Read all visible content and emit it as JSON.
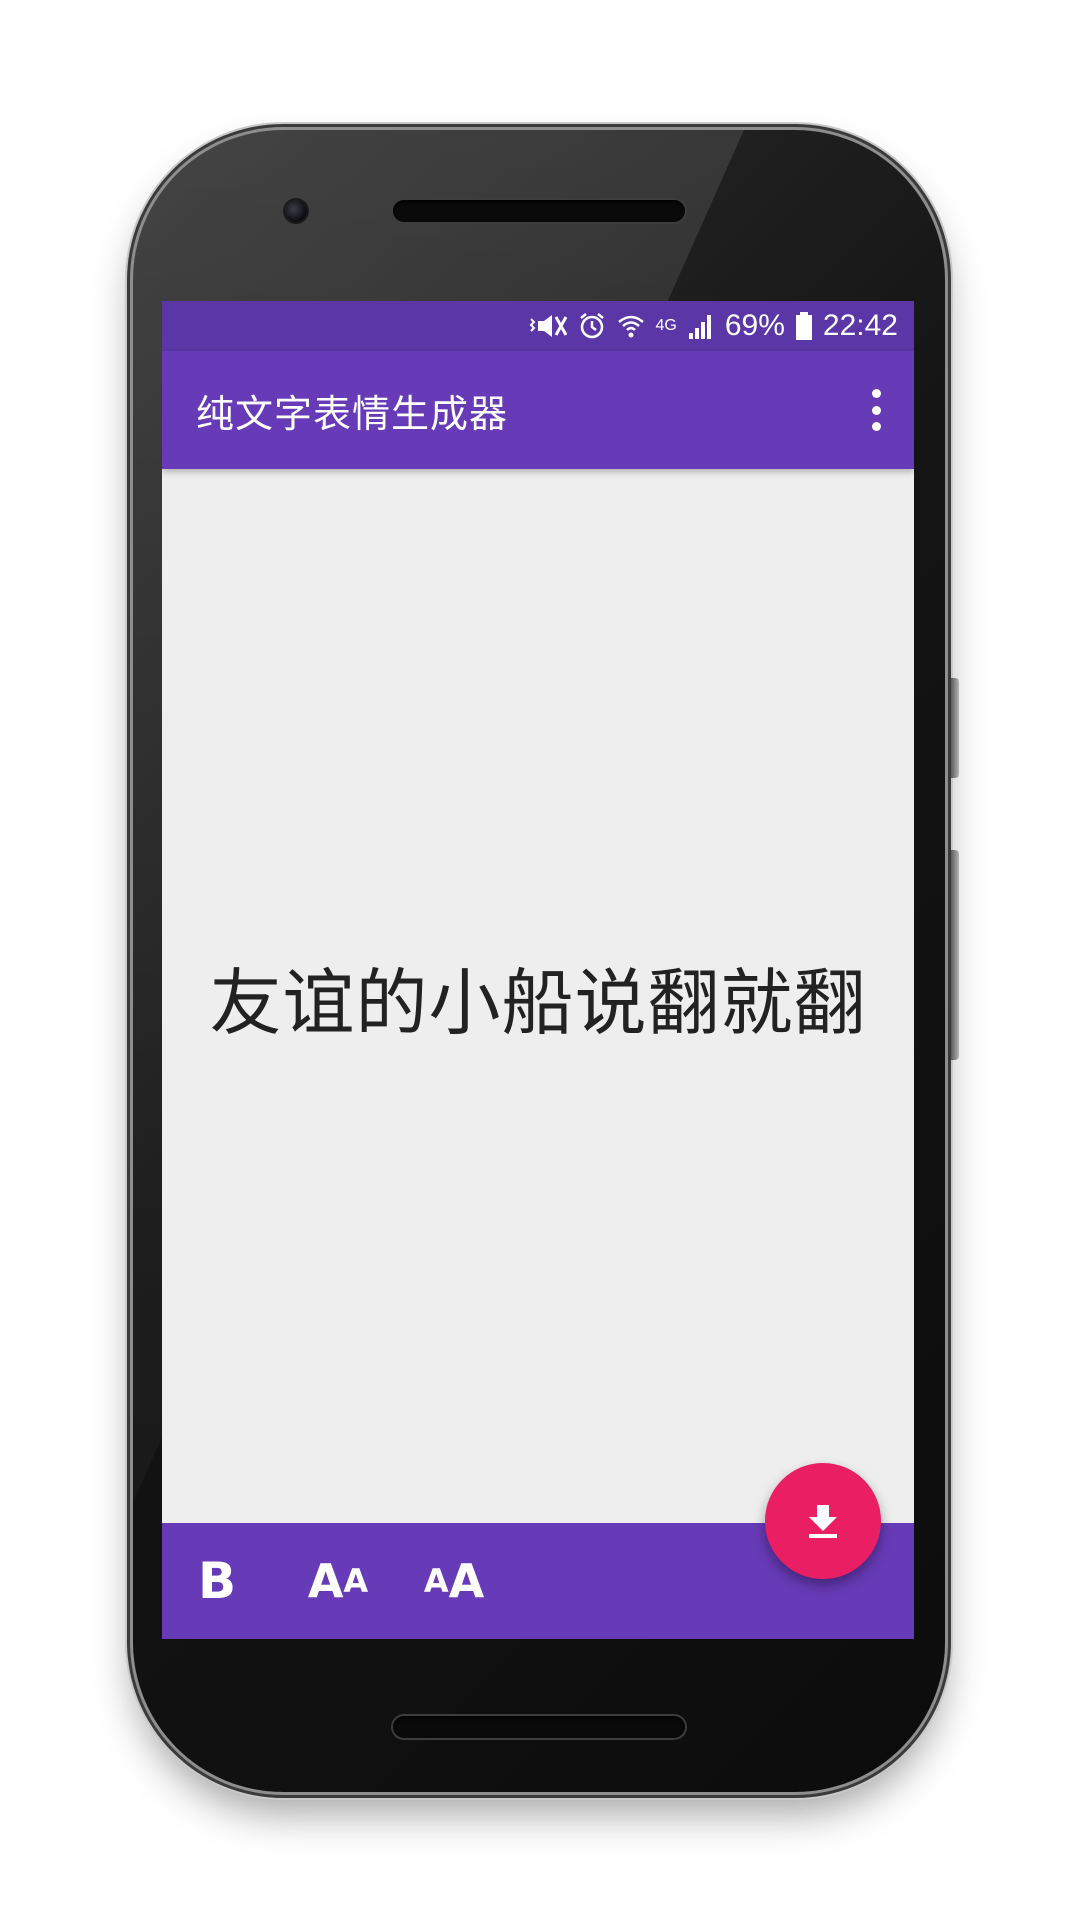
{
  "status_bar": {
    "battery": "69%",
    "time": "22:42",
    "network": "4G",
    "icons": [
      "vibrate-mute-icon",
      "alarm-icon",
      "wifi-icon",
      "signal-icon",
      "battery-icon"
    ]
  },
  "app_bar": {
    "title": "纯文字表情生成器",
    "menu_icon": "overflow-menu-icon"
  },
  "canvas": {
    "text": "友谊的小船说翻就翻"
  },
  "toolbar": {
    "bold_label": "B",
    "decrease_big": "A",
    "decrease_small": "A",
    "increase_small": "A",
    "increase_big": "A"
  },
  "fab": {
    "icon": "download-icon"
  },
  "colors": {
    "primary": "#673ab7",
    "primary_dark": "#5a36a6",
    "accent": "#e91e63",
    "canvas_bg": "#eeeeee"
  }
}
